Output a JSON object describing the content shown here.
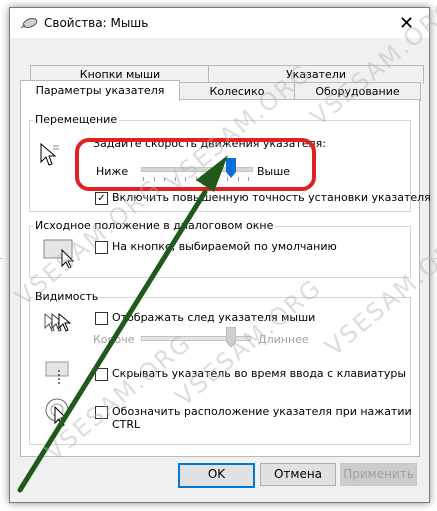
{
  "window": {
    "title": "Свойства: Мышь",
    "close_glyph": "✕"
  },
  "tabs": {
    "row_back": [
      "Кнопки мыши",
      "Указатели"
    ],
    "row_front": [
      "Параметры указателя",
      "Колесико",
      "Оборудование"
    ],
    "active": "Параметры указателя"
  },
  "motion": {
    "group_label": "Перемещение",
    "speed_prompt": "Задайте скорость движения указателя:",
    "slow_label": "Ниже",
    "fast_label": "Выше",
    "speed_level": 0.82,
    "precision_label": "Включить повышенную точность установки указателя",
    "precision_checked": true,
    "check_glyph": "✓"
  },
  "snap": {
    "group_label": "Исходное положение в диалоговом окне",
    "checkbox_label": "На кнопке, выбираемой по умолчанию",
    "checked": false
  },
  "visibility": {
    "group_label": "Видимость",
    "trail_label": "Отображать след указателя мыши",
    "trail_checked": false,
    "trail_short": "Короче",
    "trail_long": "Длиннее",
    "trail_level": 0.83,
    "hide_label": "Скрывать указатель во время ввода с клавиатуры",
    "hide_checked": false,
    "ctrl_label_line1": "Обозначить расположение указателя при нажатии",
    "ctrl_label_line2": "CTRL",
    "ctrl_checked": false
  },
  "buttons": {
    "ok": "OK",
    "cancel": "Отмена",
    "apply": "Применить"
  },
  "watermark": "VSESAM.ORG",
  "colors": {
    "highlight": "#e32020",
    "arrow": "#1f5a1a",
    "slider_thumb": "#0a6fd8",
    "default_button_border": "#0078d7"
  }
}
